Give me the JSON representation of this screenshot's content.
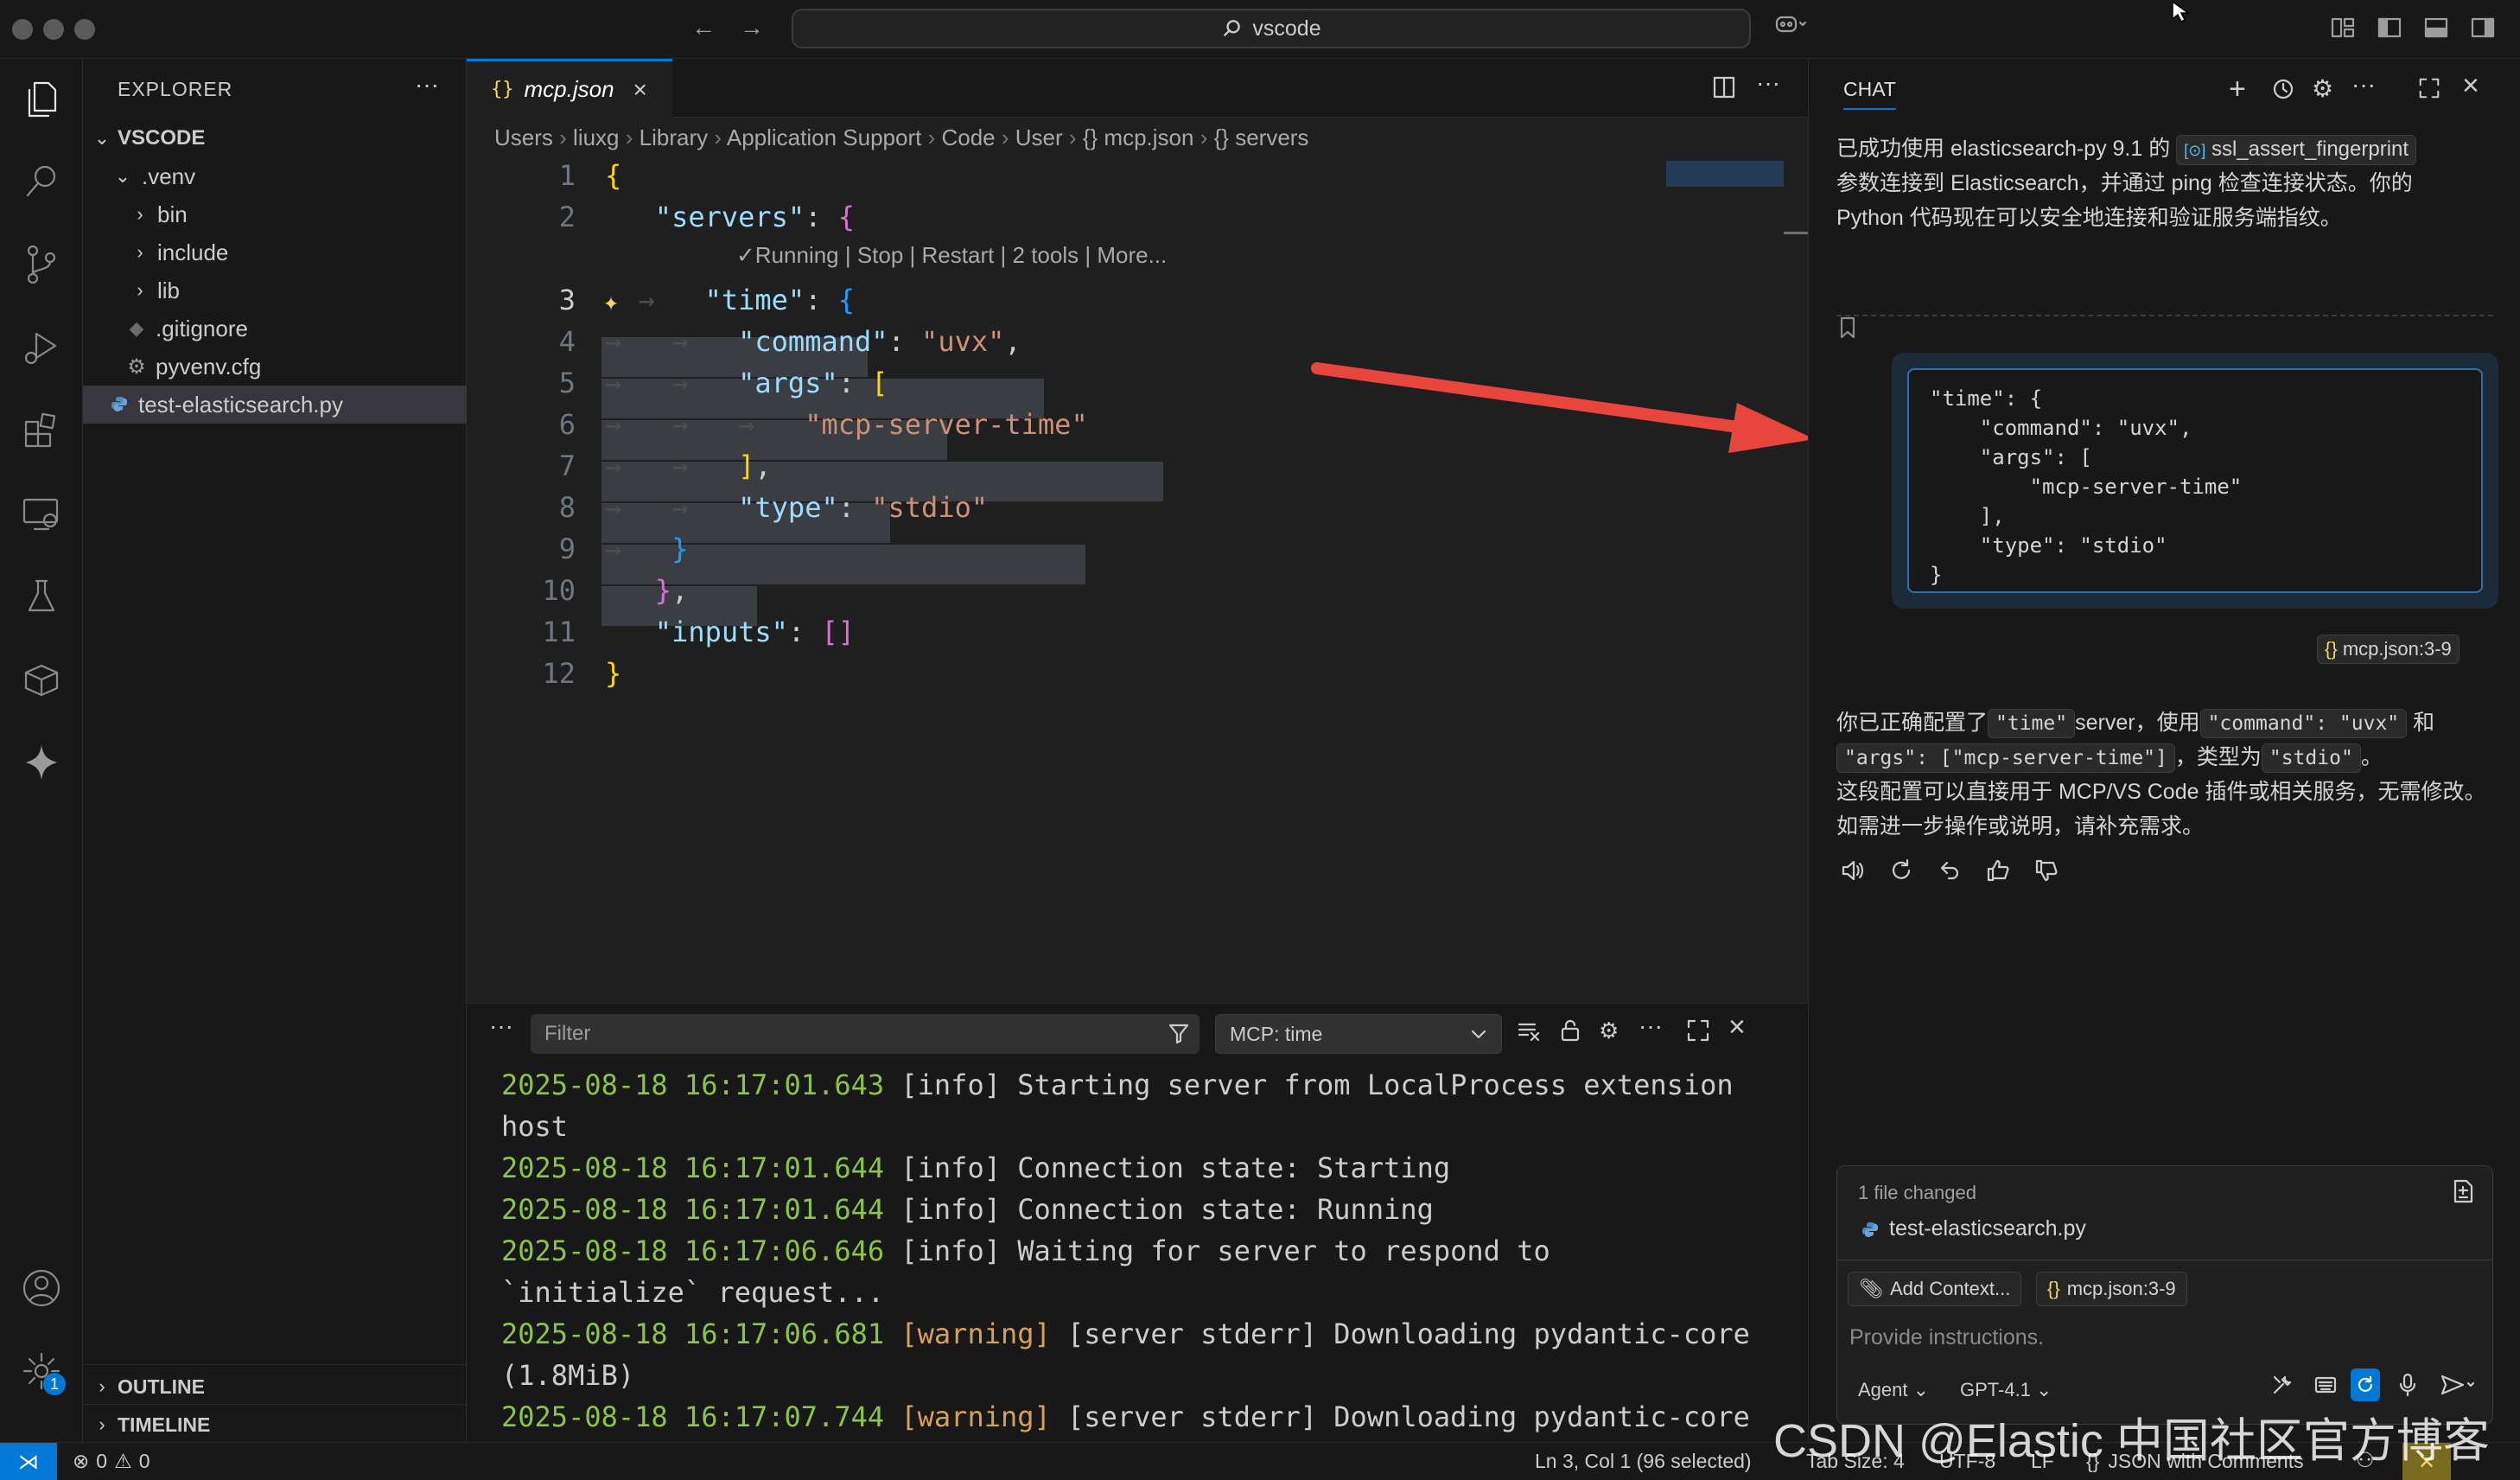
{
  "titlebar": {
    "search_text": "vscode"
  },
  "sidebar": {
    "title": "EXPLORER",
    "root": "VSCODE",
    "items": [
      {
        "label": ".venv",
        "kind": "folder-open"
      },
      {
        "label": "bin",
        "kind": "folder"
      },
      {
        "label": "include",
        "kind": "folder"
      },
      {
        "label": "lib",
        "kind": "folder"
      },
      {
        "label": ".gitignore",
        "kind": "git"
      },
      {
        "label": "pyvenv.cfg",
        "kind": "gear"
      },
      {
        "label": "test-elasticsearch.py",
        "kind": "python"
      }
    ],
    "outline": "OUTLINE",
    "timeline": "TIMELINE"
  },
  "editor": {
    "tab_icon": "{}",
    "tab_label": "mcp.json",
    "breadcrumbs": [
      "Users",
      "liuxg",
      "Library",
      "Application Support",
      "Code",
      "User",
      "{} mcp.json",
      "{} servers"
    ],
    "codelens": "✓Running | Stop | Restart | 2 tools | More...",
    "line_numbers": [
      "1",
      "2",
      "3",
      "4",
      "5",
      "6",
      "7",
      "8",
      "9",
      "10",
      "11",
      "12"
    ]
  },
  "panel": {
    "filter_placeholder": "Filter",
    "channel": "MCP: time",
    "log": [
      {
        "ts": "2025-08-18 16:17:01.643",
        "level": "[info]",
        "msg": "Starting server from LocalProcess extension"
      },
      {
        "ts": "",
        "level": "",
        "msg": "host"
      },
      {
        "ts": "2025-08-18 16:17:01.644",
        "level": "[info]",
        "msg": "Connection state: Starting"
      },
      {
        "ts": "2025-08-18 16:17:01.644",
        "level": "[info]",
        "msg": "Connection state: Running"
      },
      {
        "ts": "2025-08-18 16:17:06.646",
        "level": "[info]",
        "msg": "Waiting for server to respond to"
      },
      {
        "ts": "",
        "level": "",
        "msg": "`initialize` request..."
      },
      {
        "ts": "2025-08-18 16:17:06.681",
        "level": "[warning]",
        "msg": "[server stderr] Downloading pydantic-core"
      },
      {
        "ts": "",
        "level": "",
        "msg": "(1.8MiB)"
      },
      {
        "ts": "2025-08-18 16:17:07.744",
        "level": "[warning]",
        "msg": "[server stderr]  Downloading pydantic-core"
      }
    ]
  },
  "chat": {
    "title": "CHAT",
    "msg1_a": "已成功使用 elasticsearch-py 9.1 的",
    "msg1_chip": "ssl_assert_fingerprint",
    "msg1_b": "参数连接到 Elasticsearch，并通过 ping 检查连接状态。你的",
    "msg1_c": "Python 代码现在可以安全地连接和验证服务端指纹。",
    "code_snippet": "\"time\": {\n    \"command\": \"uvx\",\n    \"args\": [\n        \"mcp-server-time\"\n    ],\n    \"type\": \"stdio\"\n}",
    "ref_chip": "mcp.json:3-9",
    "msg2_a": "你已正确配置了",
    "msg2_chip1": "\"time\"",
    "msg2_b": "server，使用",
    "msg2_chip2": "\"command\": \"uvx\"",
    "msg2_c": "和",
    "msg2_chip3": "\"args\": [\"mcp-server-time\"]",
    "msg2_d": "，类型为",
    "msg2_chip4": "\"stdio\"",
    "msg2_e": "。",
    "msg2_line2": "这段配置可以直接用于 MCP/VS Code 插件或相关服务，无需修改。",
    "msg2_line3": "如需进一步操作或说明，请补充需求。",
    "files_changed": "1 file changed",
    "changed_file": "test-elasticsearch.py",
    "add_context": "Add Context...",
    "context_chip": "mcp.json:3-9",
    "input_placeholder": "Provide instructions.",
    "mode": "Agent",
    "model": "GPT-4.1"
  },
  "status": {
    "errors": "0",
    "warnings": "0",
    "position": "Ln 3, Col 1 (96 selected)",
    "tab_size": "Tab Size: 4",
    "encoding": "UTF-8",
    "eol": "LF",
    "language": "JSON with Comments"
  },
  "watermark": "CSDN @Elastic 中国社区官方博客",
  "colors": {
    "accent": "#0078d4",
    "annotation_arrow": "#e8453c"
  }
}
